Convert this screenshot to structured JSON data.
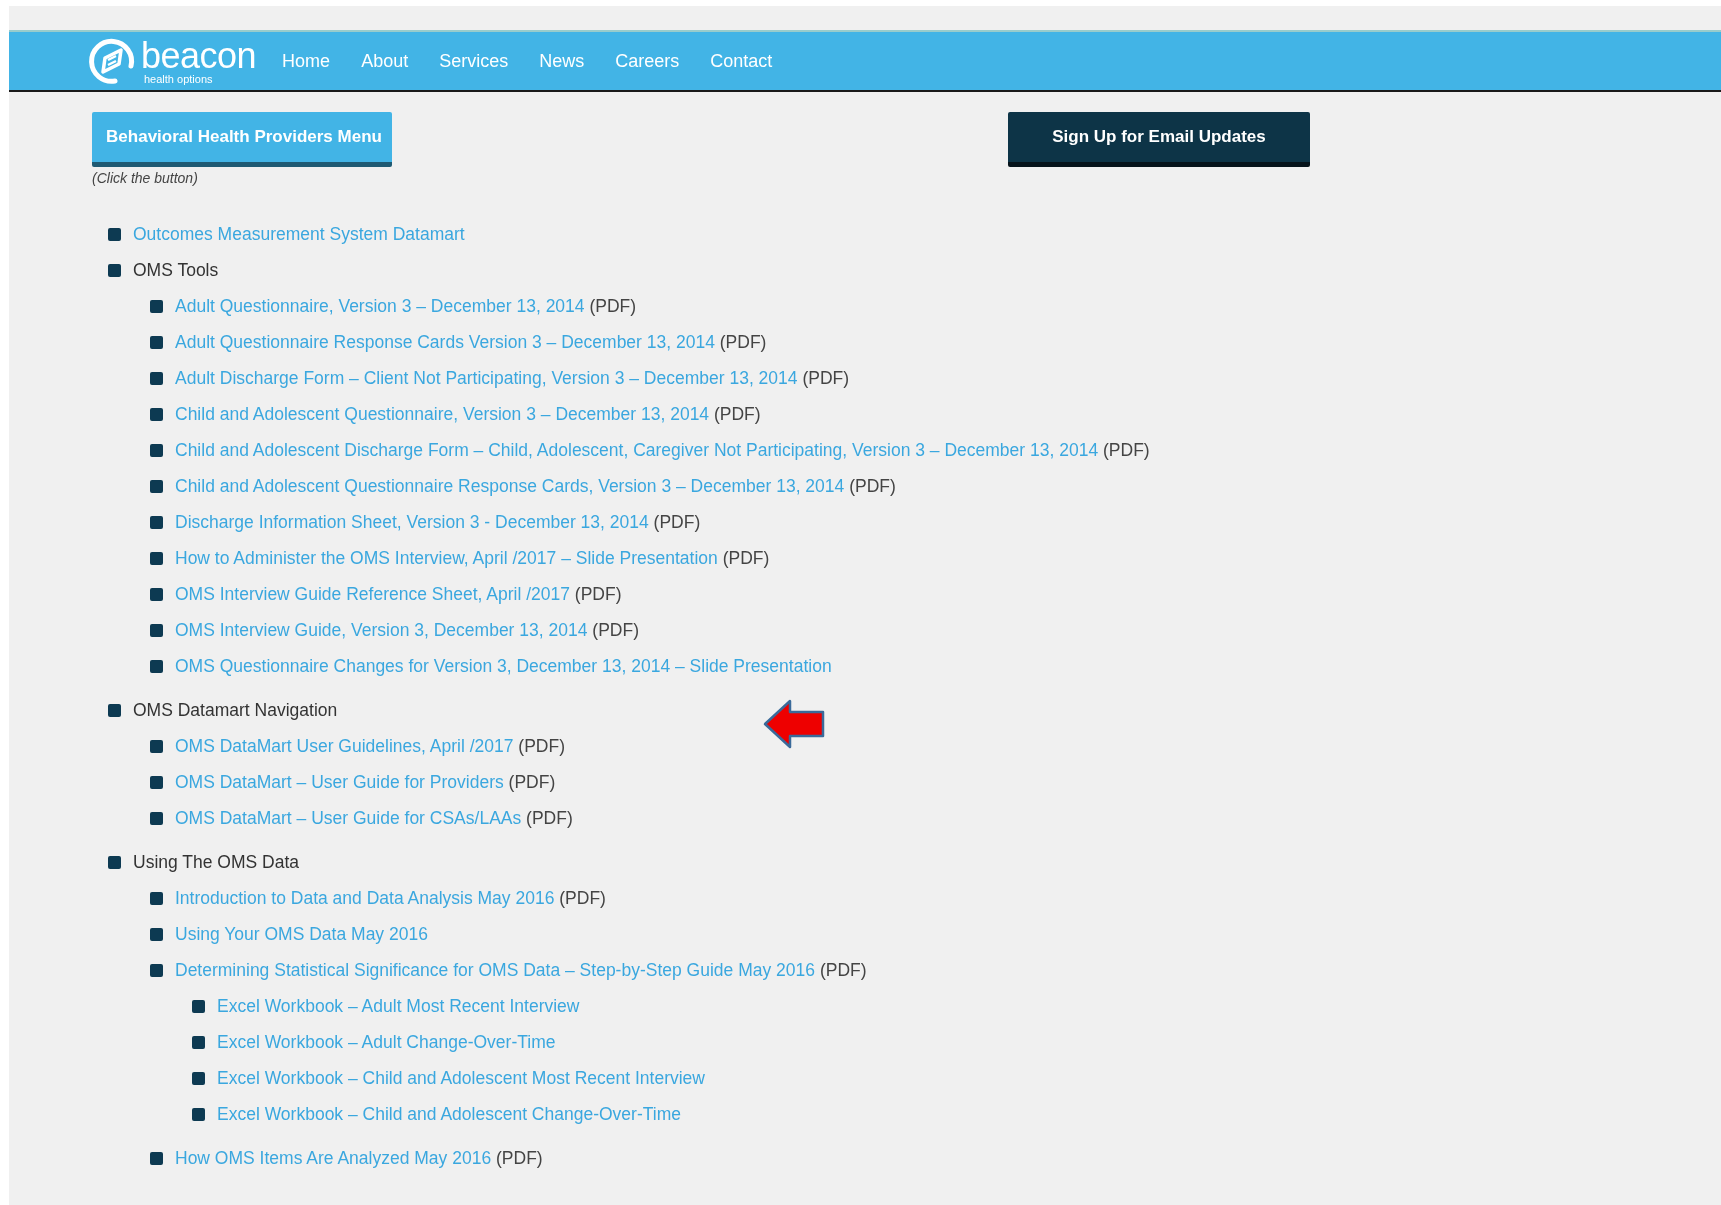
{
  "header": {
    "logo": {
      "name": "beacon",
      "tagline": "health options"
    },
    "nav": [
      "Home",
      "About",
      "Services",
      "News",
      "Careers",
      "Contact"
    ]
  },
  "menu_button": {
    "label": "Behavioral Health Providers Menu",
    "note": "(Click the button)"
  },
  "signup_button": {
    "label": "Sign Up for Email Updates"
  },
  "list": [
    {
      "text": "Outcomes Measurement System Datamart",
      "link": true
    },
    {
      "text": "OMS Tools",
      "link": false,
      "children": [
        {
          "text": "Adult Questionnaire, Version 3 – December 13, 2014",
          "link": true,
          "note": "(PDF)"
        },
        {
          "text": "Adult Questionnaire Response Cards Version 3 – December 13, 2014",
          "link": true,
          "note": "(PDF)"
        },
        {
          "text": "Adult Discharge Form – Client Not Participating, Version 3 – December 13, 2014",
          "link": true,
          "note": "(PDF)"
        },
        {
          "text": "Child and Adolescent Questionnaire, Version 3 – December 13, 2014",
          "link": true,
          "note": "(PDF)"
        },
        {
          "text": "Child and Adolescent Discharge Form – Child, Adolescent, Caregiver Not Participating, Version 3 – December 13, 2014",
          "link": true,
          "note": "(PDF)"
        },
        {
          "text": "Child and Adolescent Questionnaire Response Cards, Version 3 – December 13, 2014",
          "link": true,
          "note": "(PDF)"
        },
        {
          "text": "Discharge Information Sheet, Version 3 - December 13, 2014",
          "link": true,
          "note": "(PDF)"
        },
        {
          "text": "How to Administer the OMS Interview, April /2017 – Slide Presentation",
          "link": true,
          "note": "(PDF)"
        },
        {
          "text": "OMS Interview Guide Reference Sheet, April /2017",
          "link": true,
          "note": "(PDF)"
        },
        {
          "text": "OMS Interview Guide, Version 3, December 13, 2014",
          "link": true,
          "note": "(PDF)"
        },
        {
          "text": "OMS Questionnaire Changes for Version 3, December 13, 2014 – Slide Presentation",
          "link": true
        }
      ]
    },
    {
      "text": "OMS Datamart Navigation",
      "link": false,
      "children": [
        {
          "text": "OMS DataMart User Guidelines, April /2017",
          "link": true,
          "note": "(PDF)"
        },
        {
          "text": "OMS DataMart – User Guide for Providers",
          "link": true,
          "note": "(PDF)"
        },
        {
          "text": "OMS DataMart – User Guide for CSAs/LAAs",
          "link": true,
          "note": "(PDF)"
        }
      ]
    },
    {
      "text": "Using The OMS Data",
      "link": false,
      "children": [
        {
          "text": "Introduction to Data and Data Analysis May 2016",
          "link": true,
          "note": "(PDF)"
        },
        {
          "text": "Using Your OMS Data May 2016",
          "link": true
        },
        {
          "text": "Determining Statistical Significance for OMS Data – Step-by-Step Guide May 2016",
          "link": true,
          "note": "(PDF)",
          "children": [
            {
              "text": "Excel Workbook – Adult Most Recent Interview",
              "link": true
            },
            {
              "text": "Excel Workbook – Adult Change-Over-Time",
              "link": true
            },
            {
              "text": "Excel Workbook – Child and Adolescent Most Recent Interview",
              "link": true
            },
            {
              "text": "Excel Workbook – Child and Adolescent Change-Over-Time",
              "link": true
            }
          ]
        },
        {
          "text": "How OMS Items Are Analyzed May 2016",
          "link": true,
          "note": "(PDF)"
        }
      ]
    }
  ]
}
